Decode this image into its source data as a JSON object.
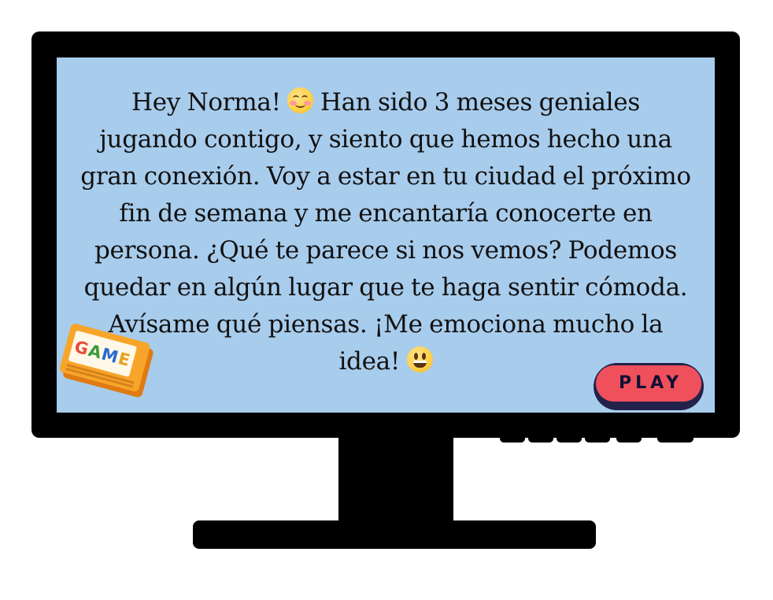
{
  "message": {
    "line1_before": "Hey Norma! ",
    "line1_after": " Han sido 3 meses geniales",
    "line2": "jugando contigo, y siento que hemos hecho una",
    "line3": "gran conexión. Voy a estar en tu ciudad el próximo",
    "line4": "fin de semana y me encantaría conocerte en",
    "line5": "persona. ¿Qué te parece si nos vemos? Podemos",
    "line6": "quedar en algún lugar que te haga sentir cómoda.",
    "line7": "Avísame qué piensas. ¡Me emociona mucho la",
    "line8_before": "idea! ",
    "emoji1": "smiling-face-with-smiling-eyes",
    "emoji2": "grinning-face-with-big-eyes"
  },
  "game_cartridge": {
    "label": "GAME",
    "letters": [
      {
        "char": "G",
        "color": "#e84a3a"
      },
      {
        "char": "A",
        "color": "#3a9a3a"
      },
      {
        "char": "M",
        "color": "#2a6ad0"
      },
      {
        "char": "E",
        "color": "#e8a020"
      }
    ]
  },
  "play_button": {
    "label": "PLAY"
  },
  "colors": {
    "screen": "#a8ccec",
    "bezel": "#000000",
    "play_fill": "#f0505c",
    "play_border": "#22224a",
    "cartridge": "#f7a52a"
  }
}
